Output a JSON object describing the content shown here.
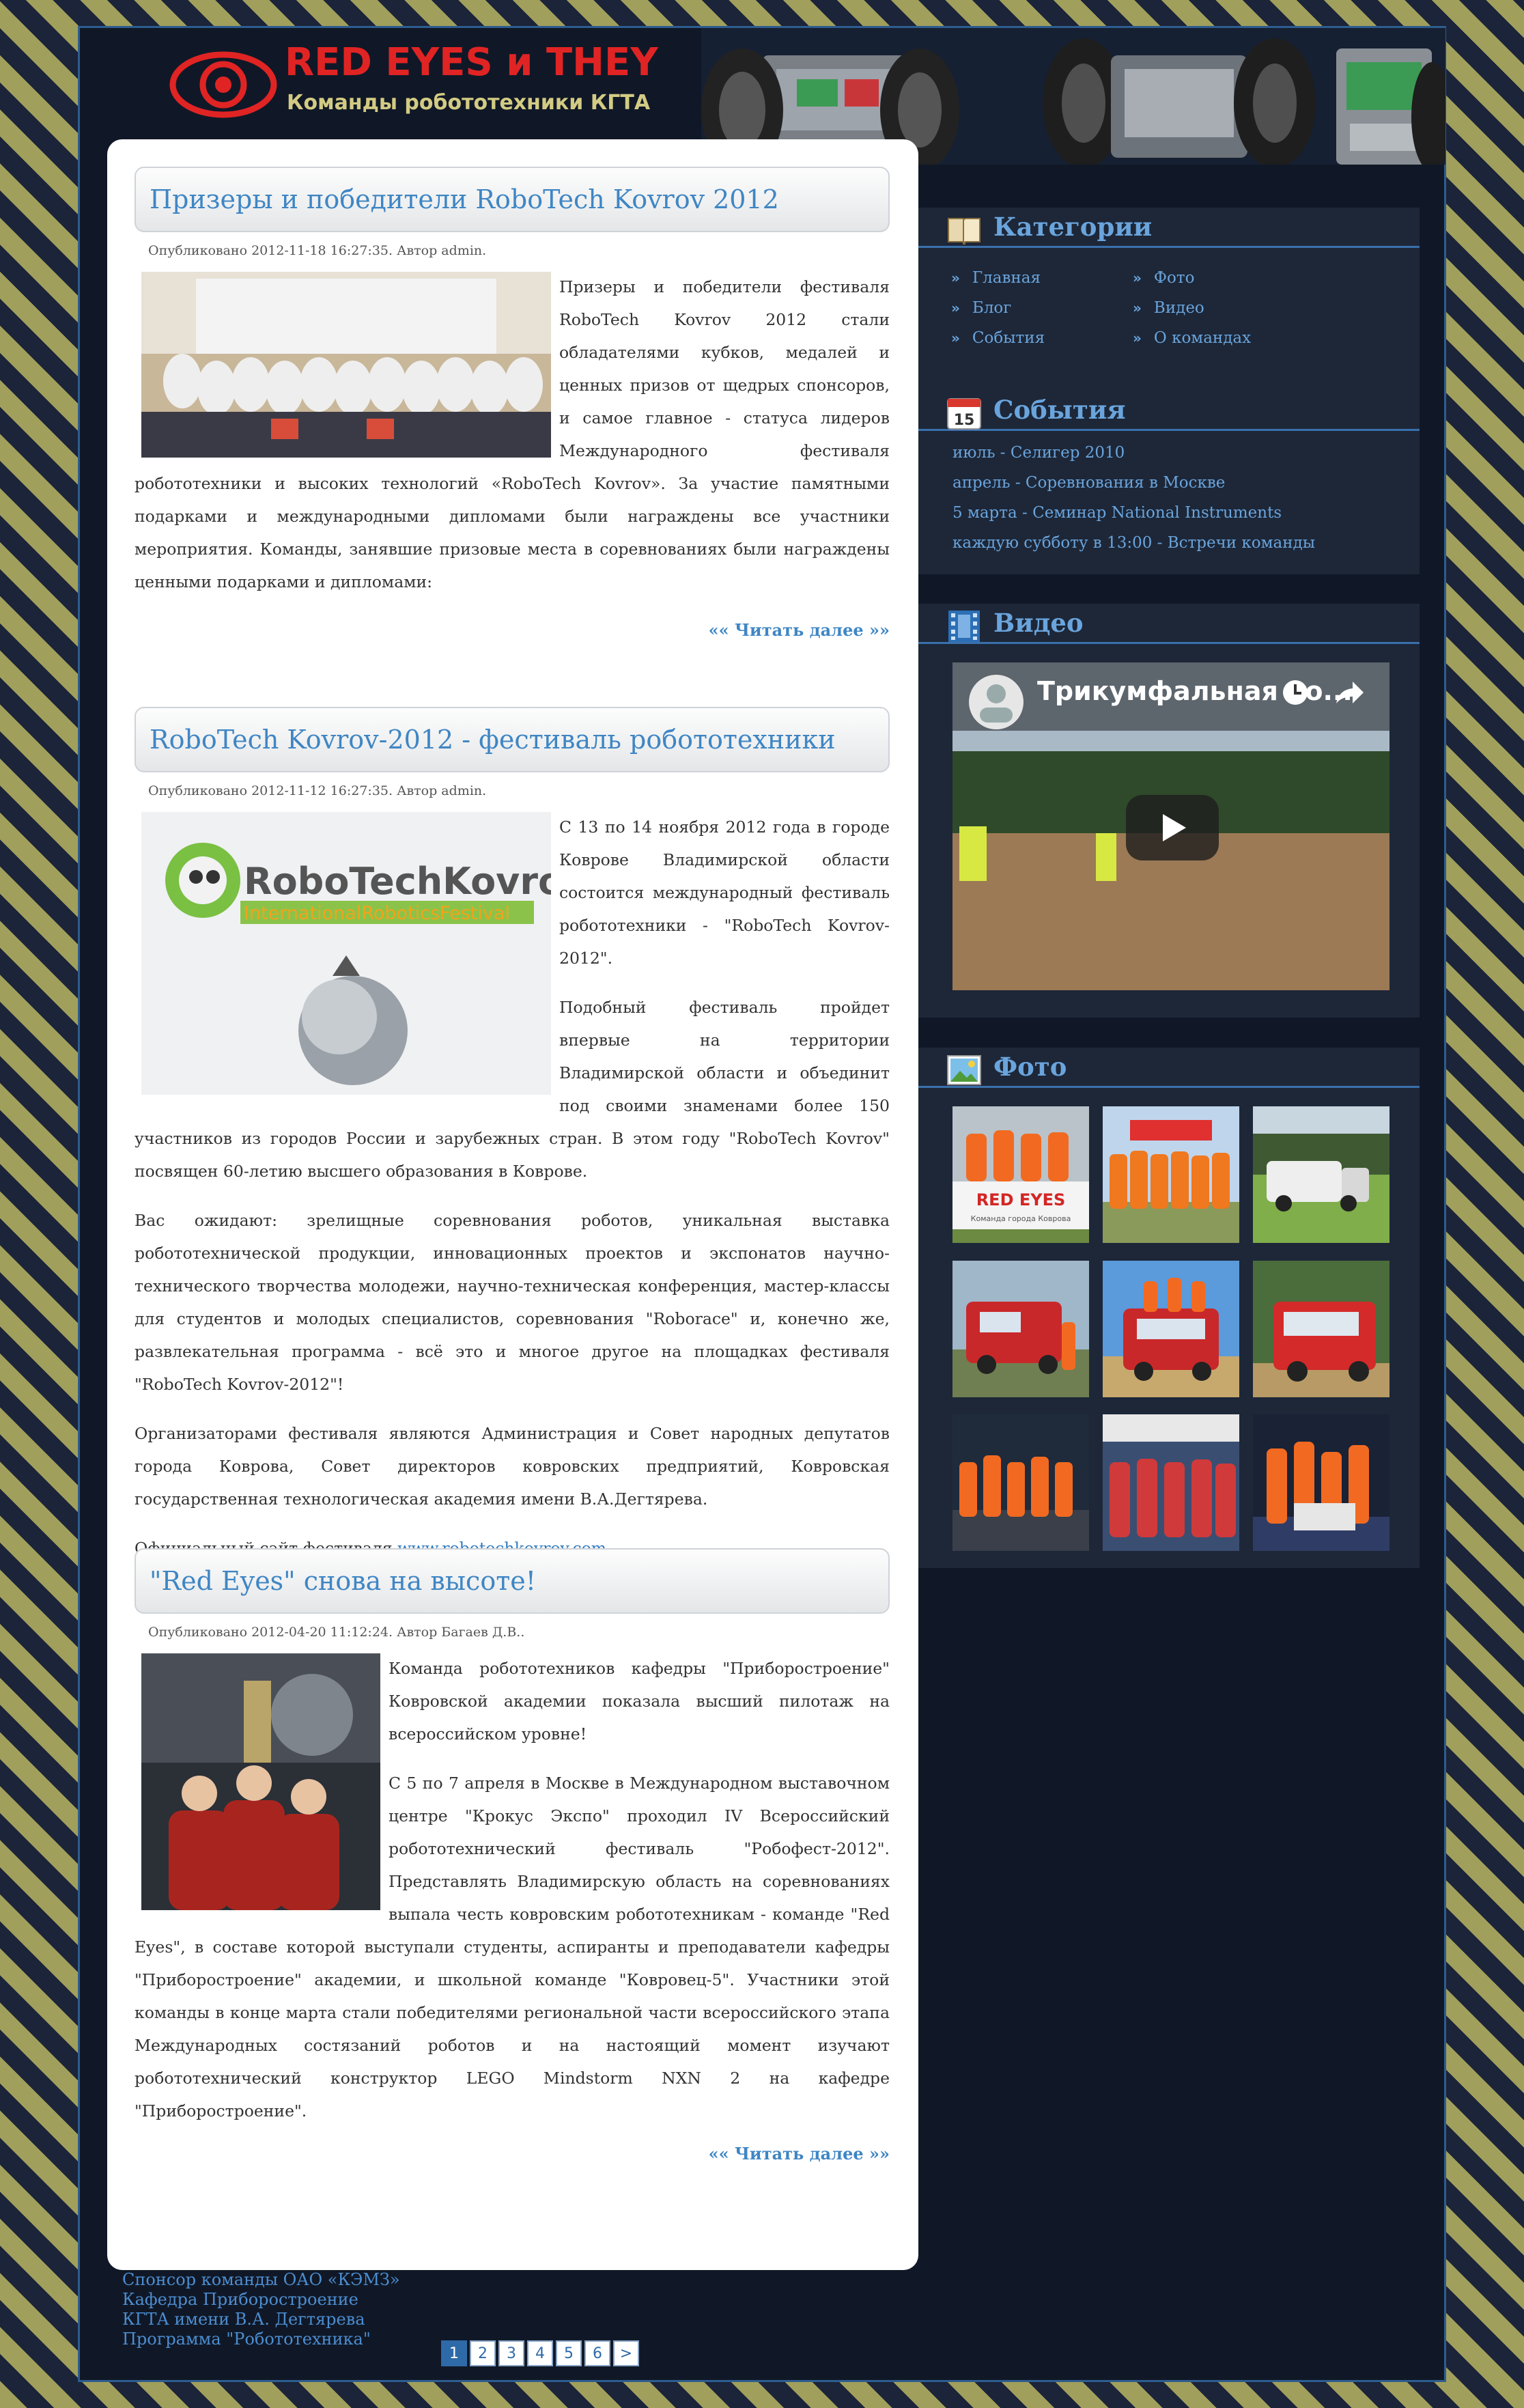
{
  "header": {
    "title": "RED EYES и THEY",
    "subtitle": "Команды робототехники КГТА"
  },
  "posts": [
    {
      "title": "Призеры и победители RoboTech Kovrov 2012",
      "meta": "Опубликовано 2012-11-18 16:27:35. Автор admin.",
      "paragraphs": [
        "Призеры и победители фестиваля RoboTech Kovrov 2012 стали обладателями кубков, медалей и ценных призов от щедрых спонсоров, и самое главное - статуса лидеров Международного фестиваля робототехники и высоких технологий «RoboTech Kovrov». За участие памятными подарками и международными дипломами были награждены все участники мероприятия. Команды, занявшие призовые места в соревнованиях были награждены ценными подарками и дипломами:"
      ],
      "read_more": "«« Читать далее »»"
    },
    {
      "title": "RoboTech Kovrov-2012 - фестиваль робототехники",
      "meta": "Опубликовано 2012-11-12 16:27:35. Автор admin.",
      "paragraphs": [
        "С 13 по 14 ноября 2012 года в городе Коврове Владимирской области состоится международный фестиваль робототехники - \"RoboTech Kovrov-2012\".",
        "Подобный фестиваль пройдет впервые на территории Владимирской области и объединит под своими знаменами более 150 участников из городов России и зарубежных стран. В этом году \"RoboTech Kovrov\" посвящен 60-летию высшего образования в Коврове.",
        "Вас ожидают: зрелищные соревнования роботов, уникальная выставка робототехнической продукции, инновационных проектов и экспонатов научно-технического творчества молодежи, научно-техническая конференция, мастер-классы для студентов и молодых специалистов, соревнования \"Roborace\" и, конечно же, развлекательная программа - всё это и многое другое на площадках фестиваля \"RoboTech Kovrov-2012\"!",
        "Организаторами фестиваля являются Администрация и Совет народных депутатов города Коврова, Совет директоров ковровских предприятий, Ковровская государственная технологическая академия имени В.А.Дегтярева."
      ],
      "official_site_label": "Официальный сайт фестиваля",
      "official_site_link": "www.robotechkovrov.com",
      "logo_text_1": "RoboTechKovrov",
      "logo_text_2": "InternationalRoboticsFestival"
    },
    {
      "title": "\"Red Eyes\" снова на высоте!",
      "meta": "Опубликовано 2012-04-20 11:12:24. Автор Багаев Д.В..",
      "paragraphs": [
        "Команда робототехников кафедры \"Приборостроение\" Ковровской академии показала высший пилотаж на всероссийском уровне!",
        "С 5 по 7 апреля в Москве в Международном выставочном центре \"Крокус Экспо\" проходил IV Всероссийский робототехнический фестиваль \"Робофест-2012\". Представлять Владимирскую область на соревнованиях выпала честь ковровским робототехникам - команде \"Red Eyes\", в составе которой выступали студенты, аспиранты и преподаватели кафедры \"Приборостроение\" академии, и школьной команде \"Ковровец-5\". Участники этой команды в конце марта стали победителями региональной части всероссийского этапа Международных состязаний роботов и на настоящий момент изучают робототехнический конструктор LEGO Mindstorm NXN 2 на кафедре \"Приборостроение\"."
      ],
      "read_more": "«« Читать далее »»"
    }
  ],
  "pagination": [
    "1",
    "2",
    "3",
    "4",
    "5",
    "6",
    ">"
  ],
  "sidebar": {
    "categories": {
      "title": "Категории",
      "items": [
        "Главная",
        "Фото",
        "Блог",
        "Видео",
        "События",
        "О командах"
      ]
    },
    "events": {
      "title": "События",
      "calendar_day": "15",
      "items": [
        "июль - Селигер 2010",
        "апрель - Соревнования в Москве",
        "5 марта - Семинар National Instruments",
        "каждую субботу в 13:00 - Встречи команды"
      ]
    },
    "video": {
      "title": "Видео",
      "video_title": "Трикумфальная по..."
    },
    "photo": {
      "title": "Фото",
      "banner_text": "RED EYES",
      "banner_sub": "Команда города Коврова"
    }
  },
  "footer": [
    "Спонсор команды ОАО «КЭМЗ»",
    "Кафедра Приборостроение",
    "КГТА имени В.А. Дегтярева",
    "Программа \"Робототехника\""
  ],
  "colors": {
    "accent": "#3f86c4",
    "title_red": "#e02424",
    "subtitle_gold": "#d3cb83",
    "panel": "#1d2738",
    "page_bg": "#101827"
  }
}
